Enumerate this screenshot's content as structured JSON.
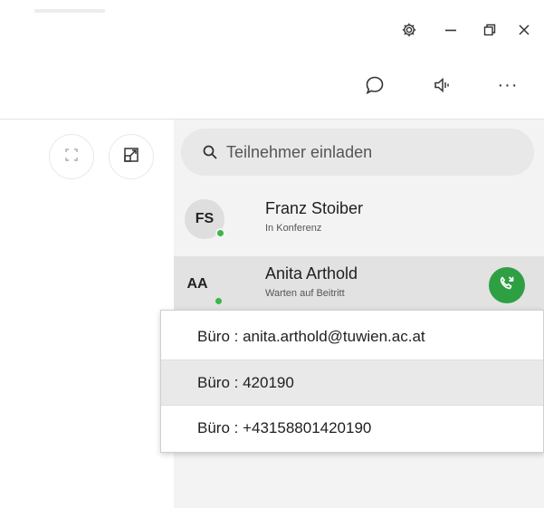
{
  "window": {
    "controls": [
      {
        "name": "settings",
        "icon": "gear-icon"
      },
      {
        "name": "minimize",
        "icon": "minimize-icon"
      },
      {
        "name": "restore",
        "icon": "restore-icon"
      },
      {
        "name": "close",
        "icon": "close-icon"
      }
    ]
  },
  "toolbar": {
    "chat_icon": "chat-bubble-icon",
    "audio_icon": "speaker-icon",
    "more_icon": "more-dots-icon",
    "more_label": "···"
  },
  "video": {
    "fullscreen_icon": "fullscreen-icon",
    "popout_icon": "popout-icon"
  },
  "search": {
    "placeholder": "Teilnehmer einladen",
    "value": ""
  },
  "participants": [
    {
      "initials": "FS",
      "name": "Franz Stoiber",
      "status": "In Konferenz",
      "presence_color": "#3cb648"
    },
    {
      "initials": "AA",
      "name": "Anita Arthold",
      "status": "Warten auf Beitritt",
      "presence_color": "#3cb648",
      "call_icon": "phone-icon",
      "call_color": "#2ea043"
    }
  ],
  "contact_menu": {
    "items": [
      {
        "label": "Büro : anita.arthold@tuwien.ac.at"
      },
      {
        "label": "Büro : 420190"
      },
      {
        "label": "Büro : +43158801420190"
      }
    ]
  },
  "colors": {
    "accent_green": "#2ea043",
    "panel_bg": "#f3f3f3",
    "selected_row": "#e2e2e2"
  }
}
